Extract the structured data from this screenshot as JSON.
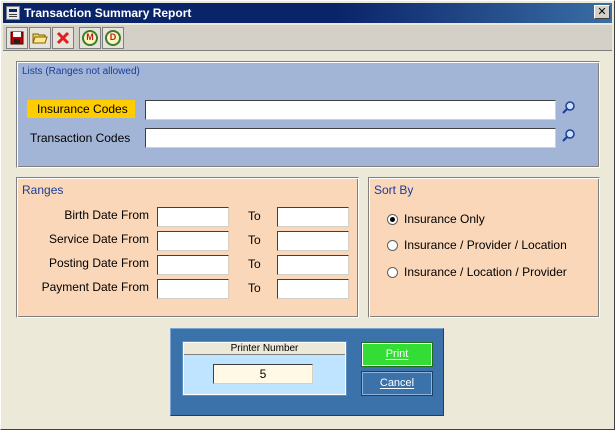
{
  "window": {
    "title": "Transaction Summary Report"
  },
  "toolbar": {
    "buttons": [
      {
        "icon": "save-icon"
      },
      {
        "icon": "open-folder-icon"
      },
      {
        "icon": "close-red-x-icon"
      },
      {
        "icon": "m-circle-icon",
        "text": "M"
      },
      {
        "icon": "d-circle-icon",
        "text": "D"
      }
    ]
  },
  "lists": {
    "title": "Lists (Ranges not allowed)",
    "insurance_codes_label": "Insurance Codes",
    "insurance_codes_value": "",
    "transaction_codes_label": "Transaction Codes",
    "transaction_codes_value": ""
  },
  "ranges": {
    "title": "Ranges",
    "to_label": "To",
    "rows": [
      {
        "label": "Birth Date From",
        "from": "",
        "to": ""
      },
      {
        "label": "Service Date From",
        "from": "",
        "to": ""
      },
      {
        "label": "Posting Date From",
        "from": "",
        "to": ""
      },
      {
        "label": "Payment Date From",
        "from": "",
        "to": ""
      }
    ]
  },
  "sort_by": {
    "title": "Sort By",
    "options": [
      {
        "label": "Insurance Only",
        "checked": true
      },
      {
        "label": "Insurance / Provider / Location",
        "checked": false
      },
      {
        "label": "Insurance / Location / Provider",
        "checked": false
      }
    ]
  },
  "printer": {
    "title": "Printer Number",
    "value": "5",
    "print_label": "Print",
    "cancel_label": "Cancel"
  },
  "colors": {
    "lists_panel": "#a3b5d6",
    "ranges_panel": "#fad7b8",
    "highlight_label": "#ffcc00",
    "print_button": "#33dd33",
    "printer_panel": "#3b72aa"
  }
}
